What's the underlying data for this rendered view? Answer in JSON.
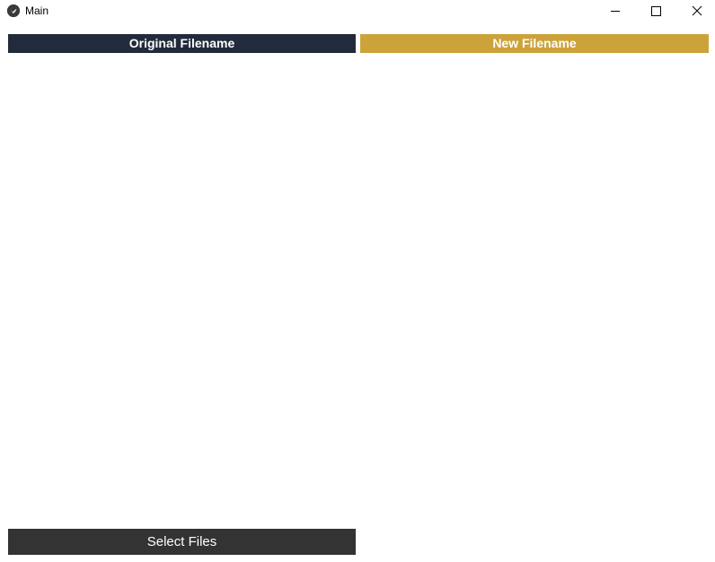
{
  "window": {
    "title": "Main",
    "icon": "kivy-app-icon"
  },
  "controls": {
    "minimize_icon": "minimize-icon",
    "maximize_icon": "maximize-icon",
    "close_icon": "close-icon"
  },
  "columns": {
    "original": {
      "label": "Original Filename",
      "color": "#222b3c",
      "items": []
    },
    "new": {
      "label": "New Filename",
      "color": "#cca33a",
      "items": []
    }
  },
  "actions": {
    "select_files_label": "Select Files",
    "select_files_color": "#333333"
  }
}
